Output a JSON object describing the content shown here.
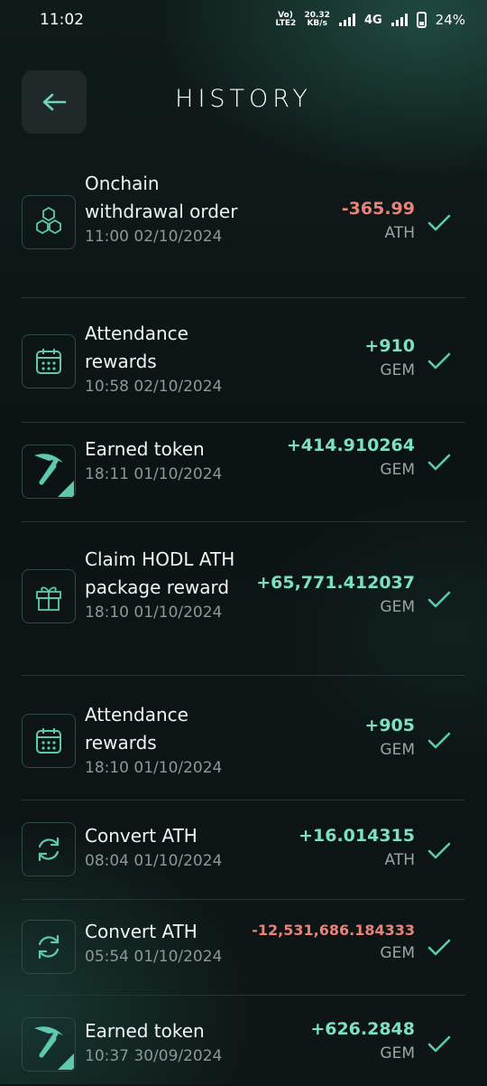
{
  "status_bar": {
    "time": "11:02",
    "volte": "Vo) LTE2",
    "speed_value": "20.32",
    "speed_unit": "KB/s",
    "network": "4G",
    "battery": "24%"
  },
  "header": {
    "title": "HISTORY"
  },
  "colors": {
    "positive": "#7be0c6",
    "negative": "#e8827b",
    "accent": "#5fc9b0"
  },
  "transactions": [
    {
      "icon": "hexagons-icon",
      "label": "Onchain withdrawal order",
      "datetime": "11:00 02/10/2024",
      "amount": "-365.99",
      "currency": "ATH",
      "sign": "negative"
    },
    {
      "icon": "calendar-icon",
      "label": "Attendance rewards",
      "datetime": "10:58 02/10/2024",
      "amount": "+910",
      "currency": "GEM",
      "sign": "positive"
    },
    {
      "icon": "pickaxe-icon",
      "label": "Earned token",
      "datetime": "18:11 01/10/2024",
      "amount": "+414.910264",
      "currency": "GEM",
      "sign": "positive"
    },
    {
      "icon": "gift-icon",
      "label": "Claim HODL ATH package reward",
      "datetime": "18:10 01/10/2024",
      "amount": "+65,771.412037",
      "currency": "GEM",
      "sign": "positive"
    },
    {
      "icon": "calendar-icon",
      "label": "Attendance rewards",
      "datetime": "18:10 01/10/2024",
      "amount": "+905",
      "currency": "GEM",
      "sign": "positive"
    },
    {
      "icon": "refresh-icon",
      "label": "Convert ATH",
      "datetime": "08:04 01/10/2024",
      "amount": "+16.014315",
      "currency": "ATH",
      "sign": "positive"
    },
    {
      "icon": "refresh-icon",
      "label": "Convert ATH",
      "datetime": "05:54 01/10/2024",
      "amount": "-12,531,686.184333",
      "currency": "GEM",
      "sign": "negative"
    },
    {
      "icon": "pickaxe-icon",
      "label": "Earned token",
      "datetime": "10:37 30/09/2024",
      "amount": "+626.2848",
      "currency": "GEM",
      "sign": "positive"
    }
  ]
}
